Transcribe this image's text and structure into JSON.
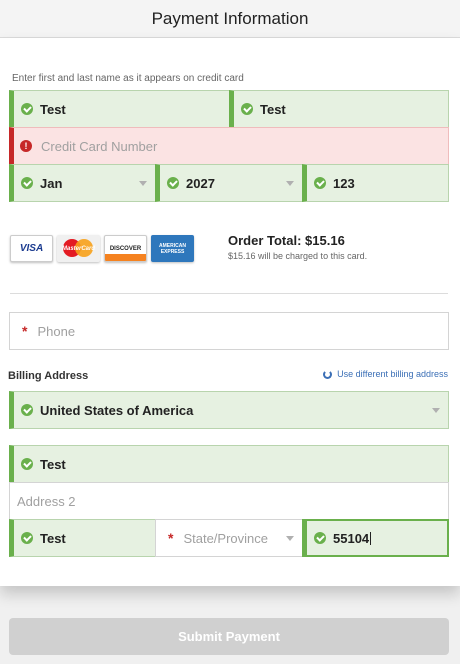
{
  "header": {
    "title": "Payment Information"
  },
  "form": {
    "name_hint": "Enter first and last name as it appears on credit card",
    "first_name": "Test",
    "last_name": "Test",
    "card_number_placeholder": "Credit Card Number",
    "exp_month": "Jan",
    "exp_year": "2027",
    "cvv": "123"
  },
  "card_logos": {
    "visa": "VISA",
    "mastercard": "MasterCard",
    "discover": "DISCOVER",
    "amex": "AMERICAN EXPRESS"
  },
  "order": {
    "total": "Order Total: $15.16",
    "note": "$15.16 will be charged to this card."
  },
  "contact": {
    "phone_placeholder": "Phone"
  },
  "billing": {
    "label": "Billing Address",
    "different_link": "Use different billing address",
    "country": "United States of America",
    "address1": "Test",
    "address2_placeholder": "Address 2",
    "city": "Test",
    "state_placeholder": "State/Province",
    "zip": "55104"
  },
  "actions": {
    "submit": "Submit Payment"
  },
  "colors": {
    "valid": "#6ab04c",
    "error": "#c62828",
    "link": "#3b6fb6",
    "disabled_button": "#d0d0d0"
  }
}
